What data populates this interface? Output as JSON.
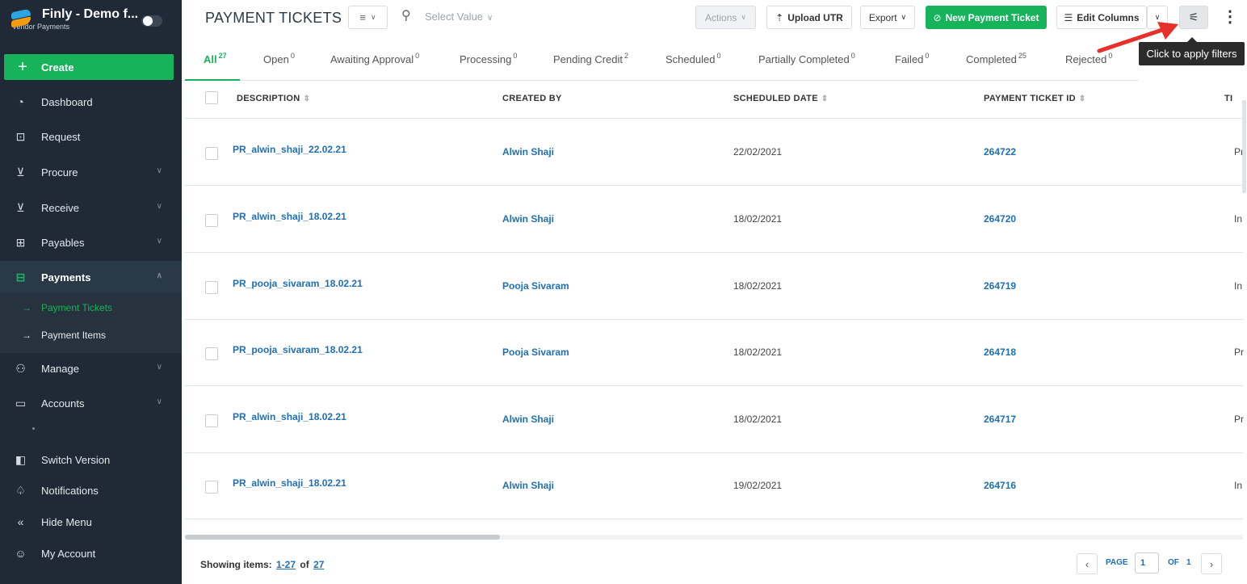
{
  "sidebar": {
    "brand": {
      "title": "Finly - Demo f...",
      "subtitle": "Vendor Payments"
    },
    "create_label": "Create",
    "items": [
      {
        "label": "Dashboard",
        "icon": "dashboard-icon"
      },
      {
        "label": "Request",
        "icon": "request-icon"
      },
      {
        "label": "Procure",
        "icon": "cart-icon"
      },
      {
        "label": "Receive",
        "icon": "receive-icon"
      },
      {
        "label": "Payables",
        "icon": "payables-icon"
      },
      {
        "label": "Payments",
        "icon": "payments-icon"
      },
      {
        "label": "Manage",
        "icon": "users-icon"
      },
      {
        "label": "Accounts",
        "icon": "wallet-icon"
      },
      {
        "label": "Switch Version",
        "icon": "switch-icon"
      },
      {
        "label": "Notifications",
        "icon": "bell-icon"
      },
      {
        "label": "Hide Menu",
        "icon": "double-chevron-left-icon"
      },
      {
        "label": "My Account",
        "icon": "user-icon"
      }
    ],
    "subitems": [
      {
        "label": "Payment Tickets"
      },
      {
        "label": "Payment Items"
      }
    ]
  },
  "header": {
    "title": "PAYMENT TICKETS",
    "select_placeholder": "Select Value",
    "actions_label": "Actions",
    "upload_label": "Upload UTR",
    "export_label": "Export",
    "new_ticket_label": "New Payment Ticket",
    "edit_columns_label": "Edit Columns"
  },
  "tooltip": "Click to apply filters",
  "tabs": [
    {
      "label": "All",
      "count": "27"
    },
    {
      "label": "Open",
      "count": "0"
    },
    {
      "label": "Awaiting Approval",
      "count": "0"
    },
    {
      "label": "Processing",
      "count": "0"
    },
    {
      "label": "Pending Credit",
      "count": "2"
    },
    {
      "label": "Scheduled",
      "count": "0"
    },
    {
      "label": "Partially Completed",
      "count": "0"
    },
    {
      "label": "Failed",
      "count": "0"
    },
    {
      "label": "Completed",
      "count": "25"
    },
    {
      "label": "Rejected",
      "count": "0"
    }
  ],
  "table": {
    "columns": [
      "DESCRIPTION",
      "CREATED BY",
      "SCHEDULED DATE",
      "PAYMENT TICKET ID",
      "TI"
    ],
    "rows": [
      {
        "description": "PR_alwin_shaji_22.02.21",
        "created_by": "Alwin Shaji",
        "scheduled_date": "22/02/2021",
        "ticket_id": "264722",
        "extra": "Pr"
      },
      {
        "description": "PR_alwin_shaji_18.02.21",
        "created_by": "Alwin Shaji",
        "scheduled_date": "18/02/2021",
        "ticket_id": "264720",
        "extra": "In"
      },
      {
        "description": "PR_pooja_sivaram_18.02.21",
        "created_by": "Pooja Sivaram",
        "scheduled_date": "18/02/2021",
        "ticket_id": "264719",
        "extra": "In"
      },
      {
        "description": "PR_pooja_sivaram_18.02.21",
        "created_by": "Pooja Sivaram",
        "scheduled_date": "18/02/2021",
        "ticket_id": "264718",
        "extra": "Pr"
      },
      {
        "description": "PR_alwin_shaji_18.02.21",
        "created_by": "Alwin Shaji",
        "scheduled_date": "18/02/2021",
        "ticket_id": "264717",
        "extra": "Pr"
      },
      {
        "description": "PR_alwin_shaji_18.02.21",
        "created_by": "Alwin Shaji",
        "scheduled_date": "19/02/2021",
        "ticket_id": "264716",
        "extra": "In"
      }
    ]
  },
  "footer": {
    "showing_label": "Showing items:",
    "range": "1-27",
    "of_label": "of",
    "total": "27",
    "page_label": "PAGE",
    "page_value": "1",
    "page_of_label": "OF",
    "page_total": "1"
  },
  "colors": {
    "accent": "#17b35a",
    "sidebar": "#1f2a36",
    "link": "#1f6fb5",
    "annotation": "#e8302b"
  }
}
